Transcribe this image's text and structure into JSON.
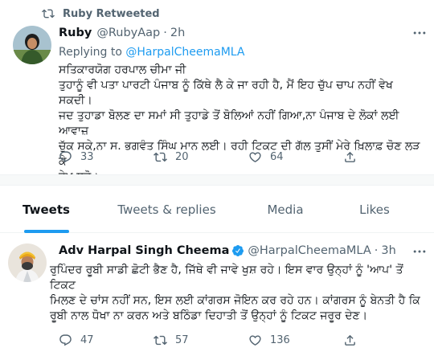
{
  "retweet": {
    "label": "Ruby Retweeted"
  },
  "tweet1": {
    "name": "Ruby",
    "handle": "@RubyAap",
    "dot": "·",
    "time": "2h",
    "replying_prefix": "Replying to ",
    "replying_mention": "@HarpalCheemaMLA",
    "lines": [
      "ਸਤਿਕਾਰਯੋਗ ਹਰਪਾਲ ਚੀਮਾ ਜੀ",
      "ਤੁਹਾਨੂੰ ਵੀ ਪਤਾ ਪਾਰਟੀ ਪੰਜਾਬ ਨੂੰ ਕਿੱਥੇ ਲੈ ਕੇ ਜਾ ਰਹੀ ਹੈ, ਮੈਂ ਇਹ ਚੁੱਪ ਚਾਪ ਨਹੀਂ ਵੇਖ ਸਕਦੀ।",
      "ਜਦ ਤੁਹਾਡਾ ਬੋਲਣ ਦਾ ਸਮਾਂ ਸੀ ਤੁਹਾਡੇ ਤੋਂ ਬੋਲਿਆਂ ਨਹੀਂ ਗਿਆ,ਨਾ ਪੰਜਾਬ ਦੇ ਲੋਕਾਂ ਲਈ ਆਵਾਜ਼",
      "ਚੁੱਕ ਸਕੇ,ਨਾ ਸ. ਭਗਵੰਤ ਸਿੰਘ ਮਾਨ ਲਈ। ਰਹੀ ਟਿਕਟ ਦੀ ਗੱਲ ਤੁਸੀਂ ਮੇਰੇ ਖ਼ਿਲਾਫ਼ ਚੋਣ ਲੜ ਕੇ",
      "ਵੇਖ ਲਵੋ।"
    ],
    "replies": "33",
    "retweets": "20",
    "likes": "64"
  },
  "tabs": [
    {
      "label": "Tweets"
    },
    {
      "label": "Tweets & replies"
    },
    {
      "label": "Media"
    },
    {
      "label": "Likes"
    }
  ],
  "tweet2": {
    "name": "Adv Harpal Singh Cheema",
    "handle": "@HarpalCheemaMLA",
    "dot": "·",
    "time": "3h",
    "lines": [
      "ਰੁਪਿੰਦਰ ਰੂਬੀ ਸਾਡੀ ਛੋਟੀ ਭੈਣ ਹੈ, ਜਿੱਥੇ ਵੀ ਜਾਵੇ ਖੁਸ਼ ਰਹੇ। ਇਸ ਵਾਰ ਉਨ੍ਹਾਂ ਨੂੰ 'ਆਪ' ਤੋਂ ਟਿਕਟ",
      "ਮਿਲਣ ਦੇ ਚਾਂਸ ਨਹੀਂ ਸਨ, ਇਸ ਲਈ ਕਾਂਗਰਸ ਜੋਇਨ ਕਰ ਰਹੇ ਹਨ। ਕਾਂਗਰਸ ਨੂੰ ਬੇਨਤੀ ਹੈ ਕਿ",
      "ਰੂਬੀ ਨਾਲ ਧੋਖਾ ਨਾ ਕਰਨ ਅਤੇ ਬਠਿੰਡਾ ਦਿਹਾਤੀ ਤੋਂ ਉਨ੍ਹਾਂ ਨੂੰ ਟਿਕਟ ਜਰੂਰ ਦੇਣ।"
    ],
    "replies": "47",
    "retweets": "57",
    "likes": "136"
  },
  "colors": {
    "accent": "#1d9bf0",
    "text_primary": "#0f1419",
    "text_secondary": "#536471",
    "divider": "#eff3f4"
  },
  "icons": {
    "retweet": "retweet-icon",
    "verified": "verified-badge-icon",
    "reply": "reply-icon",
    "like": "heart-icon",
    "share": "share-icon",
    "more": "more-icon"
  }
}
